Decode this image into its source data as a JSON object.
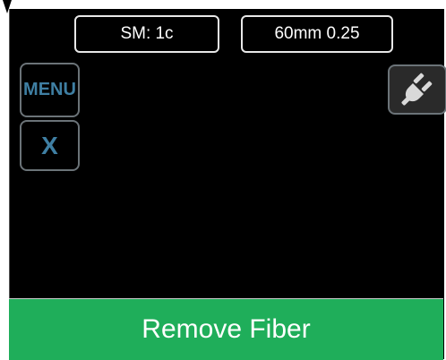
{
  "header": {
    "mode_label": "SM: 1c",
    "cutter_label": "60mm 0.25"
  },
  "sidebar": {
    "menu_label": "MENU",
    "close_label": "X"
  },
  "icons": {
    "power_plug": "plug-icon",
    "corner_marker": "down-arrow-marker-icon"
  },
  "status": {
    "message": "Remove Fiber"
  },
  "colors": {
    "status_bar": "#1fae5a",
    "button_text": "#3f7fa3",
    "screen_background": "#000000"
  }
}
